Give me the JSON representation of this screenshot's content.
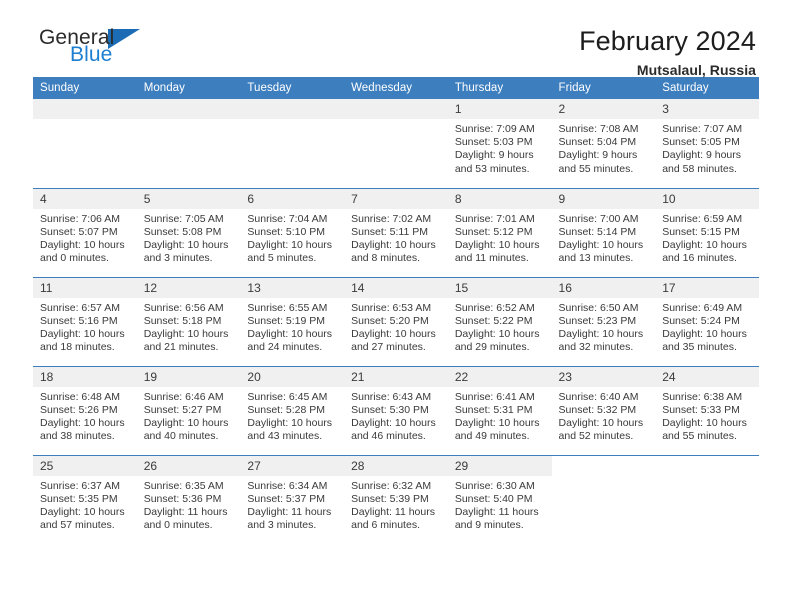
{
  "brand": {
    "name_part1": "General",
    "name_part2": "Blue",
    "logo_icon": "triangle-flag-icon",
    "accent_color": "#1c7fd1"
  },
  "header": {
    "title": "February 2024",
    "subtitle": "Mutsalaul, Russia"
  },
  "theme": {
    "header_blue": "#3d7ebf",
    "daynum_bg": "#f0f0f0"
  },
  "calendar": {
    "weekday_headers": [
      "Sunday",
      "Monday",
      "Tuesday",
      "Wednesday",
      "Thursday",
      "Friday",
      "Saturday"
    ],
    "weeks": [
      [
        {
          "day": "",
          "empty": true,
          "lines": []
        },
        {
          "day": "",
          "empty": true,
          "lines": []
        },
        {
          "day": "",
          "empty": true,
          "lines": []
        },
        {
          "day": "",
          "empty": true,
          "lines": []
        },
        {
          "day": "1",
          "lines": [
            "Sunrise: 7:09 AM",
            "Sunset: 5:03 PM",
            "Daylight: 9 hours",
            "and 53 minutes."
          ]
        },
        {
          "day": "2",
          "lines": [
            "Sunrise: 7:08 AM",
            "Sunset: 5:04 PM",
            "Daylight: 9 hours",
            "and 55 minutes."
          ]
        },
        {
          "day": "3",
          "lines": [
            "Sunrise: 7:07 AM",
            "Sunset: 5:05 PM",
            "Daylight: 9 hours",
            "and 58 minutes."
          ]
        }
      ],
      [
        {
          "day": "4",
          "lines": [
            "Sunrise: 7:06 AM",
            "Sunset: 5:07 PM",
            "Daylight: 10 hours",
            "and 0 minutes."
          ]
        },
        {
          "day": "5",
          "lines": [
            "Sunrise: 7:05 AM",
            "Sunset: 5:08 PM",
            "Daylight: 10 hours",
            "and 3 minutes."
          ]
        },
        {
          "day": "6",
          "lines": [
            "Sunrise: 7:04 AM",
            "Sunset: 5:10 PM",
            "Daylight: 10 hours",
            "and 5 minutes."
          ]
        },
        {
          "day": "7",
          "lines": [
            "Sunrise: 7:02 AM",
            "Sunset: 5:11 PM",
            "Daylight: 10 hours",
            "and 8 minutes."
          ]
        },
        {
          "day": "8",
          "lines": [
            "Sunrise: 7:01 AM",
            "Sunset: 5:12 PM",
            "Daylight: 10 hours",
            "and 11 minutes."
          ]
        },
        {
          "day": "9",
          "lines": [
            "Sunrise: 7:00 AM",
            "Sunset: 5:14 PM",
            "Daylight: 10 hours",
            "and 13 minutes."
          ]
        },
        {
          "day": "10",
          "lines": [
            "Sunrise: 6:59 AM",
            "Sunset: 5:15 PM",
            "Daylight: 10 hours",
            "and 16 minutes."
          ]
        }
      ],
      [
        {
          "day": "11",
          "lines": [
            "Sunrise: 6:57 AM",
            "Sunset: 5:16 PM",
            "Daylight: 10 hours",
            "and 18 minutes."
          ]
        },
        {
          "day": "12",
          "lines": [
            "Sunrise: 6:56 AM",
            "Sunset: 5:18 PM",
            "Daylight: 10 hours",
            "and 21 minutes."
          ]
        },
        {
          "day": "13",
          "lines": [
            "Sunrise: 6:55 AM",
            "Sunset: 5:19 PM",
            "Daylight: 10 hours",
            "and 24 minutes."
          ]
        },
        {
          "day": "14",
          "lines": [
            "Sunrise: 6:53 AM",
            "Sunset: 5:20 PM",
            "Daylight: 10 hours",
            "and 27 minutes."
          ]
        },
        {
          "day": "15",
          "lines": [
            "Sunrise: 6:52 AM",
            "Sunset: 5:22 PM",
            "Daylight: 10 hours",
            "and 29 minutes."
          ]
        },
        {
          "day": "16",
          "lines": [
            "Sunrise: 6:50 AM",
            "Sunset: 5:23 PM",
            "Daylight: 10 hours",
            "and 32 minutes."
          ]
        },
        {
          "day": "17",
          "lines": [
            "Sunrise: 6:49 AM",
            "Sunset: 5:24 PM",
            "Daylight: 10 hours",
            "and 35 minutes."
          ]
        }
      ],
      [
        {
          "day": "18",
          "lines": [
            "Sunrise: 6:48 AM",
            "Sunset: 5:26 PM",
            "Daylight: 10 hours",
            "and 38 minutes."
          ]
        },
        {
          "day": "19",
          "lines": [
            "Sunrise: 6:46 AM",
            "Sunset: 5:27 PM",
            "Daylight: 10 hours",
            "and 40 minutes."
          ]
        },
        {
          "day": "20",
          "lines": [
            "Sunrise: 6:45 AM",
            "Sunset: 5:28 PM",
            "Daylight: 10 hours",
            "and 43 minutes."
          ]
        },
        {
          "day": "21",
          "lines": [
            "Sunrise: 6:43 AM",
            "Sunset: 5:30 PM",
            "Daylight: 10 hours",
            "and 46 minutes."
          ]
        },
        {
          "day": "22",
          "lines": [
            "Sunrise: 6:41 AM",
            "Sunset: 5:31 PM",
            "Daylight: 10 hours",
            "and 49 minutes."
          ]
        },
        {
          "day": "23",
          "lines": [
            "Sunrise: 6:40 AM",
            "Sunset: 5:32 PM",
            "Daylight: 10 hours",
            "and 52 minutes."
          ]
        },
        {
          "day": "24",
          "lines": [
            "Sunrise: 6:38 AM",
            "Sunset: 5:33 PM",
            "Daylight: 10 hours",
            "and 55 minutes."
          ]
        }
      ],
      [
        {
          "day": "25",
          "lines": [
            "Sunrise: 6:37 AM",
            "Sunset: 5:35 PM",
            "Daylight: 10 hours",
            "and 57 minutes."
          ]
        },
        {
          "day": "26",
          "lines": [
            "Sunrise: 6:35 AM",
            "Sunset: 5:36 PM",
            "Daylight: 11 hours",
            "and 0 minutes."
          ]
        },
        {
          "day": "27",
          "lines": [
            "Sunrise: 6:34 AM",
            "Sunset: 5:37 PM",
            "Daylight: 11 hours",
            "and 3 minutes."
          ]
        },
        {
          "day": "28",
          "lines": [
            "Sunrise: 6:32 AM",
            "Sunset: 5:39 PM",
            "Daylight: 11 hours",
            "and 6 minutes."
          ]
        },
        {
          "day": "29",
          "lines": [
            "Sunrise: 6:30 AM",
            "Sunset: 5:40 PM",
            "Daylight: 11 hours",
            "and 9 minutes."
          ]
        },
        {
          "day": "",
          "blank": true,
          "lines": []
        },
        {
          "day": "",
          "blank": true,
          "lines": []
        }
      ]
    ]
  }
}
